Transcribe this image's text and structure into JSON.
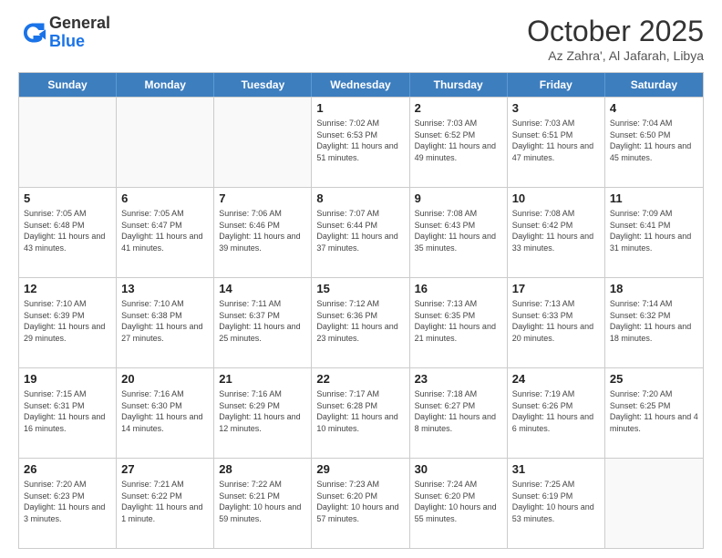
{
  "header": {
    "logo_general": "General",
    "logo_blue": "Blue",
    "month_title": "October 2025",
    "subtitle": "Az Zahra', Al Jafarah, Libya"
  },
  "calendar": {
    "days_of_week": [
      "Sunday",
      "Monday",
      "Tuesday",
      "Wednesday",
      "Thursday",
      "Friday",
      "Saturday"
    ],
    "weeks": [
      [
        {
          "day": null
        },
        {
          "day": null
        },
        {
          "day": null
        },
        {
          "day": "1",
          "sunrise": "Sunrise: 7:02 AM",
          "sunset": "Sunset: 6:53 PM",
          "daylight": "Daylight: 11 hours and 51 minutes."
        },
        {
          "day": "2",
          "sunrise": "Sunrise: 7:03 AM",
          "sunset": "Sunset: 6:52 PM",
          "daylight": "Daylight: 11 hours and 49 minutes."
        },
        {
          "day": "3",
          "sunrise": "Sunrise: 7:03 AM",
          "sunset": "Sunset: 6:51 PM",
          "daylight": "Daylight: 11 hours and 47 minutes."
        },
        {
          "day": "4",
          "sunrise": "Sunrise: 7:04 AM",
          "sunset": "Sunset: 6:50 PM",
          "daylight": "Daylight: 11 hours and 45 minutes."
        }
      ],
      [
        {
          "day": "5",
          "sunrise": "Sunrise: 7:05 AM",
          "sunset": "Sunset: 6:48 PM",
          "daylight": "Daylight: 11 hours and 43 minutes."
        },
        {
          "day": "6",
          "sunrise": "Sunrise: 7:05 AM",
          "sunset": "Sunset: 6:47 PM",
          "daylight": "Daylight: 11 hours and 41 minutes."
        },
        {
          "day": "7",
          "sunrise": "Sunrise: 7:06 AM",
          "sunset": "Sunset: 6:46 PM",
          "daylight": "Daylight: 11 hours and 39 minutes."
        },
        {
          "day": "8",
          "sunrise": "Sunrise: 7:07 AM",
          "sunset": "Sunset: 6:44 PM",
          "daylight": "Daylight: 11 hours and 37 minutes."
        },
        {
          "day": "9",
          "sunrise": "Sunrise: 7:08 AM",
          "sunset": "Sunset: 6:43 PM",
          "daylight": "Daylight: 11 hours and 35 minutes."
        },
        {
          "day": "10",
          "sunrise": "Sunrise: 7:08 AM",
          "sunset": "Sunset: 6:42 PM",
          "daylight": "Daylight: 11 hours and 33 minutes."
        },
        {
          "day": "11",
          "sunrise": "Sunrise: 7:09 AM",
          "sunset": "Sunset: 6:41 PM",
          "daylight": "Daylight: 11 hours and 31 minutes."
        }
      ],
      [
        {
          "day": "12",
          "sunrise": "Sunrise: 7:10 AM",
          "sunset": "Sunset: 6:39 PM",
          "daylight": "Daylight: 11 hours and 29 minutes."
        },
        {
          "day": "13",
          "sunrise": "Sunrise: 7:10 AM",
          "sunset": "Sunset: 6:38 PM",
          "daylight": "Daylight: 11 hours and 27 minutes."
        },
        {
          "day": "14",
          "sunrise": "Sunrise: 7:11 AM",
          "sunset": "Sunset: 6:37 PM",
          "daylight": "Daylight: 11 hours and 25 minutes."
        },
        {
          "day": "15",
          "sunrise": "Sunrise: 7:12 AM",
          "sunset": "Sunset: 6:36 PM",
          "daylight": "Daylight: 11 hours and 23 minutes."
        },
        {
          "day": "16",
          "sunrise": "Sunrise: 7:13 AM",
          "sunset": "Sunset: 6:35 PM",
          "daylight": "Daylight: 11 hours and 21 minutes."
        },
        {
          "day": "17",
          "sunrise": "Sunrise: 7:13 AM",
          "sunset": "Sunset: 6:33 PM",
          "daylight": "Daylight: 11 hours and 20 minutes."
        },
        {
          "day": "18",
          "sunrise": "Sunrise: 7:14 AM",
          "sunset": "Sunset: 6:32 PM",
          "daylight": "Daylight: 11 hours and 18 minutes."
        }
      ],
      [
        {
          "day": "19",
          "sunrise": "Sunrise: 7:15 AM",
          "sunset": "Sunset: 6:31 PM",
          "daylight": "Daylight: 11 hours and 16 minutes."
        },
        {
          "day": "20",
          "sunrise": "Sunrise: 7:16 AM",
          "sunset": "Sunset: 6:30 PM",
          "daylight": "Daylight: 11 hours and 14 minutes."
        },
        {
          "day": "21",
          "sunrise": "Sunrise: 7:16 AM",
          "sunset": "Sunset: 6:29 PM",
          "daylight": "Daylight: 11 hours and 12 minutes."
        },
        {
          "day": "22",
          "sunrise": "Sunrise: 7:17 AM",
          "sunset": "Sunset: 6:28 PM",
          "daylight": "Daylight: 11 hours and 10 minutes."
        },
        {
          "day": "23",
          "sunrise": "Sunrise: 7:18 AM",
          "sunset": "Sunset: 6:27 PM",
          "daylight": "Daylight: 11 hours and 8 minutes."
        },
        {
          "day": "24",
          "sunrise": "Sunrise: 7:19 AM",
          "sunset": "Sunset: 6:26 PM",
          "daylight": "Daylight: 11 hours and 6 minutes."
        },
        {
          "day": "25",
          "sunrise": "Sunrise: 7:20 AM",
          "sunset": "Sunset: 6:25 PM",
          "daylight": "Daylight: 11 hours and 4 minutes."
        }
      ],
      [
        {
          "day": "26",
          "sunrise": "Sunrise: 7:20 AM",
          "sunset": "Sunset: 6:23 PM",
          "daylight": "Daylight: 11 hours and 3 minutes."
        },
        {
          "day": "27",
          "sunrise": "Sunrise: 7:21 AM",
          "sunset": "Sunset: 6:22 PM",
          "daylight": "Daylight: 11 hours and 1 minute."
        },
        {
          "day": "28",
          "sunrise": "Sunrise: 7:22 AM",
          "sunset": "Sunset: 6:21 PM",
          "daylight": "Daylight: 10 hours and 59 minutes."
        },
        {
          "day": "29",
          "sunrise": "Sunrise: 7:23 AM",
          "sunset": "Sunset: 6:20 PM",
          "daylight": "Daylight: 10 hours and 57 minutes."
        },
        {
          "day": "30",
          "sunrise": "Sunrise: 7:24 AM",
          "sunset": "Sunset: 6:20 PM",
          "daylight": "Daylight: 10 hours and 55 minutes."
        },
        {
          "day": "31",
          "sunrise": "Sunrise: 7:25 AM",
          "sunset": "Sunset: 6:19 PM",
          "daylight": "Daylight: 10 hours and 53 minutes."
        },
        {
          "day": null
        }
      ]
    ]
  }
}
